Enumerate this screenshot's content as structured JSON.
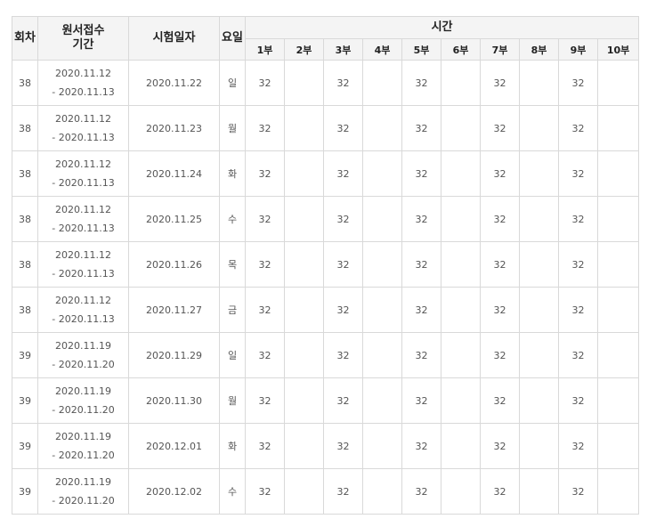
{
  "headers": {
    "round": "회차",
    "application_period_line1": "원서접수",
    "application_period_line2": "기간",
    "exam_date": "시험일자",
    "weekday": "요일",
    "time": "시간",
    "sessions": [
      "1부",
      "2부",
      "3부",
      "4부",
      "5부",
      "6부",
      "7부",
      "8부",
      "9부",
      "10부"
    ]
  },
  "rows": [
    {
      "round": "38",
      "period_start": "2020.11.12",
      "period_end": "- 2020.11.13",
      "exam_date": "2020.11.22",
      "weekday": "일",
      "sessions": [
        "32",
        "",
        "32",
        "",
        "32",
        "",
        "32",
        "",
        "32",
        ""
      ]
    },
    {
      "round": "38",
      "period_start": "2020.11.12",
      "period_end": "- 2020.11.13",
      "exam_date": "2020.11.23",
      "weekday": "월",
      "sessions": [
        "32",
        "",
        "32",
        "",
        "32",
        "",
        "32",
        "",
        "32",
        ""
      ]
    },
    {
      "round": "38",
      "period_start": "2020.11.12",
      "period_end": "- 2020.11.13",
      "exam_date": "2020.11.24",
      "weekday": "화",
      "sessions": [
        "32",
        "",
        "32",
        "",
        "32",
        "",
        "32",
        "",
        "32",
        ""
      ]
    },
    {
      "round": "38",
      "period_start": "2020.11.12",
      "period_end": "- 2020.11.13",
      "exam_date": "2020.11.25",
      "weekday": "수",
      "sessions": [
        "32",
        "",
        "32",
        "",
        "32",
        "",
        "32",
        "",
        "32",
        ""
      ]
    },
    {
      "round": "38",
      "period_start": "2020.11.12",
      "period_end": "- 2020.11.13",
      "exam_date": "2020.11.26",
      "weekday": "목",
      "sessions": [
        "32",
        "",
        "32",
        "",
        "32",
        "",
        "32",
        "",
        "32",
        ""
      ]
    },
    {
      "round": "38",
      "period_start": "2020.11.12",
      "period_end": "- 2020.11.13",
      "exam_date": "2020.11.27",
      "weekday": "금",
      "sessions": [
        "32",
        "",
        "32",
        "",
        "32",
        "",
        "32",
        "",
        "32",
        ""
      ]
    },
    {
      "round": "39",
      "period_start": "2020.11.19",
      "period_end": "- 2020.11.20",
      "exam_date": "2020.11.29",
      "weekday": "일",
      "sessions": [
        "32",
        "",
        "32",
        "",
        "32",
        "",
        "32",
        "",
        "32",
        ""
      ]
    },
    {
      "round": "39",
      "period_start": "2020.11.19",
      "period_end": "- 2020.11.20",
      "exam_date": "2020.11.30",
      "weekday": "월",
      "sessions": [
        "32",
        "",
        "32",
        "",
        "32",
        "",
        "32",
        "",
        "32",
        ""
      ]
    },
    {
      "round": "39",
      "period_start": "2020.11.19",
      "period_end": "- 2020.11.20",
      "exam_date": "2020.12.01",
      "weekday": "화",
      "sessions": [
        "32",
        "",
        "32",
        "",
        "32",
        "",
        "32",
        "",
        "32",
        ""
      ]
    },
    {
      "round": "39",
      "period_start": "2020.11.19",
      "period_end": "- 2020.11.20",
      "exam_date": "2020.12.02",
      "weekday": "수",
      "sessions": [
        "32",
        "",
        "32",
        "",
        "32",
        "",
        "32",
        "",
        "32",
        ""
      ]
    }
  ]
}
